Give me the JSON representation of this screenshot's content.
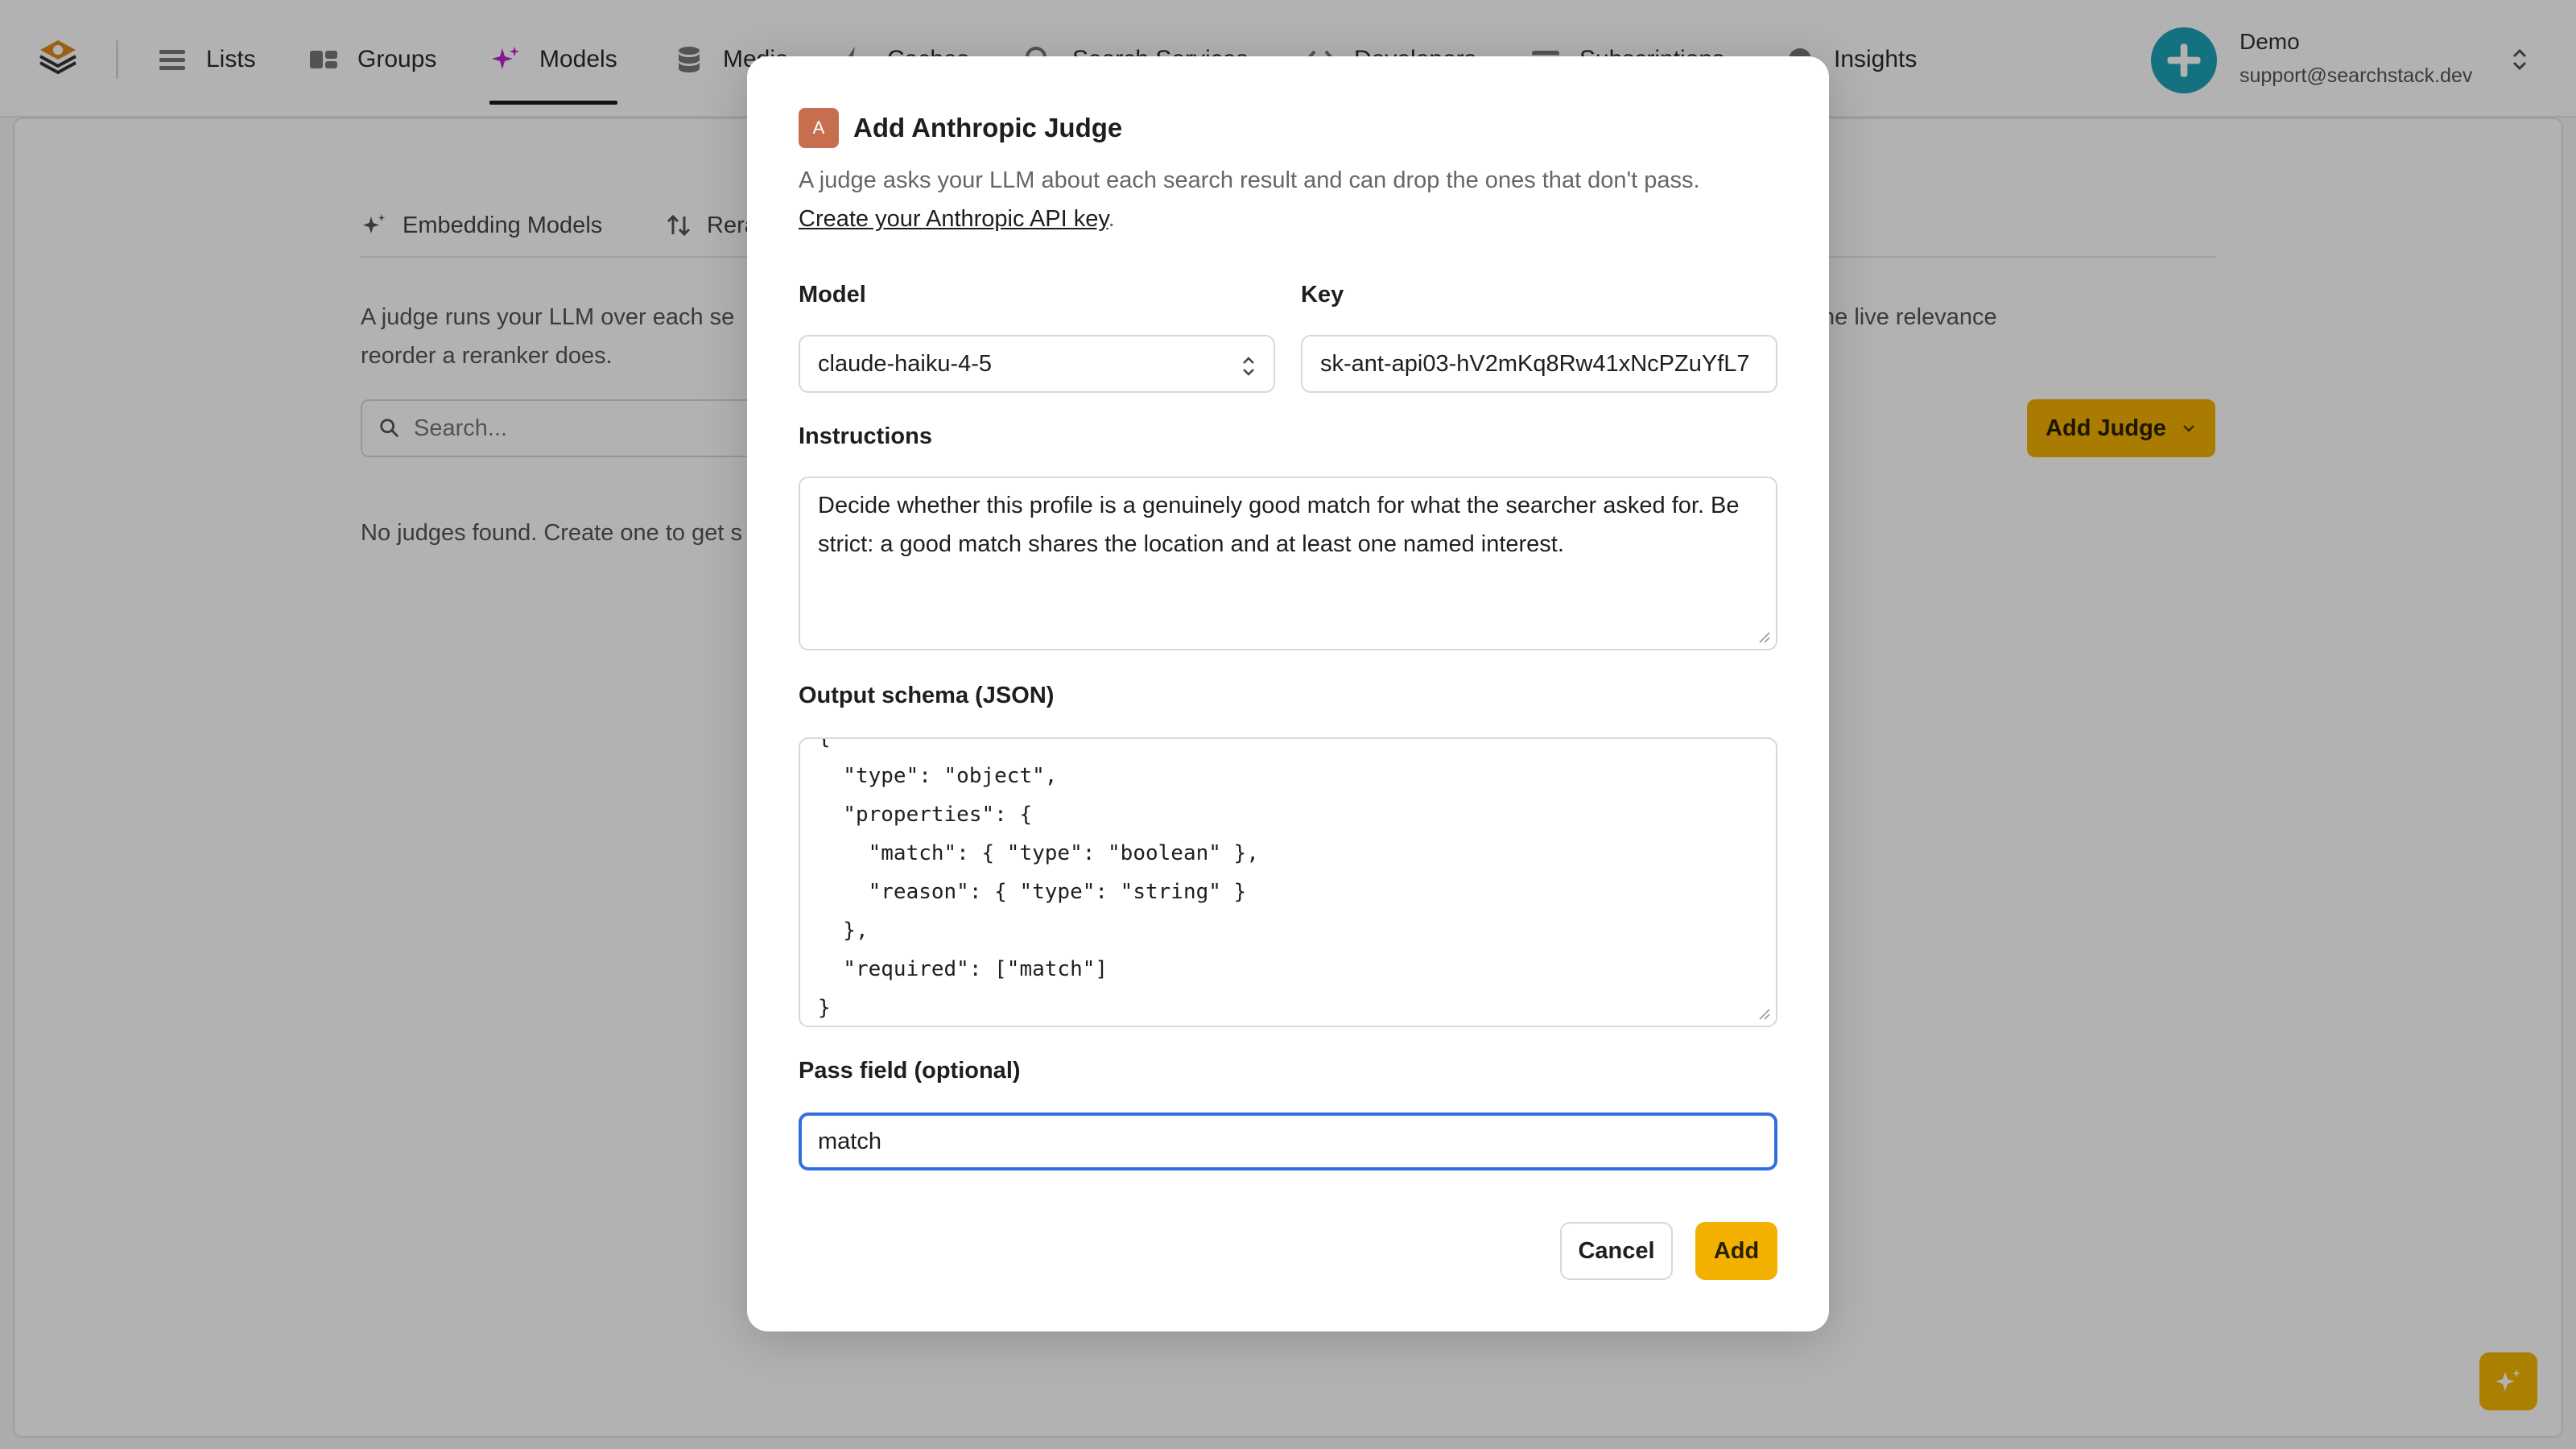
{
  "nav": {
    "items": [
      {
        "label": "Lists",
        "icon": "list-icon"
      },
      {
        "label": "Groups",
        "icon": "groups-icon"
      },
      {
        "label": "Models",
        "icon": "sparkle-icon",
        "active": true
      },
      {
        "label": "Media",
        "icon": "database-icon"
      },
      {
        "label": "Caches",
        "icon": "cache-icon"
      },
      {
        "label": "Search Services",
        "icon": "search-icon"
      },
      {
        "label": "Developers",
        "icon": "code-icon"
      },
      {
        "label": "Subscriptions",
        "icon": "card-icon"
      },
      {
        "label": "Insights",
        "icon": "insights-icon"
      }
    ]
  },
  "user": {
    "name": "Demo",
    "email": "support@searchstack.dev"
  },
  "page": {
    "tabs": [
      {
        "label": "Embedding Models",
        "icon": "sparkle-icon"
      },
      {
        "label": "Rera",
        "icon": "rerank-icon"
      }
    ],
    "description_line1_left": "A judge runs your LLM over each se",
    "description_line1_right": "he live relevance",
    "description_line2": "reorder a reranker does.",
    "search_placeholder": "Search...",
    "add_judge_label": "Add Judge",
    "empty_text": "No judges found. Create one to get s"
  },
  "modal": {
    "provider_badge": "A",
    "title": "Add Anthropic Judge",
    "description": "A judge asks your LLM about each search result and can drop the ones that don't pass.",
    "link_text": "Create your Anthropic API key",
    "model_label": "Model",
    "model_value": "claude-haiku-4-5",
    "key_label": "Key",
    "key_value": "sk-ant-api03-hV2mKq8Rw41xNcPZuYfL7",
    "instructions_label": "Instructions",
    "instructions_value": "Decide whether this profile is a genuinely good match for what the searcher asked for. Be strict: a good match shares the location and at least one named interest.",
    "schema_label": "Output schema (JSON)",
    "schema_value": "{\n  \"type\": \"object\",\n  \"properties\": {\n    \"match\": { \"type\": \"boolean\" },\n    \"reason\": { \"type\": \"string\" }\n  },\n  \"required\": [\"match\"]\n}",
    "pass_field_label": "Pass field (optional)",
    "pass_field_value": "match",
    "cancel_label": "Cancel",
    "add_label": "Add"
  },
  "colors": {
    "accent": "#f2b100",
    "models_icon": "#c026d3",
    "avatar": "#1ea3b8",
    "anthropic_badge": "#c66e4e",
    "focus": "#2f6fe0"
  }
}
